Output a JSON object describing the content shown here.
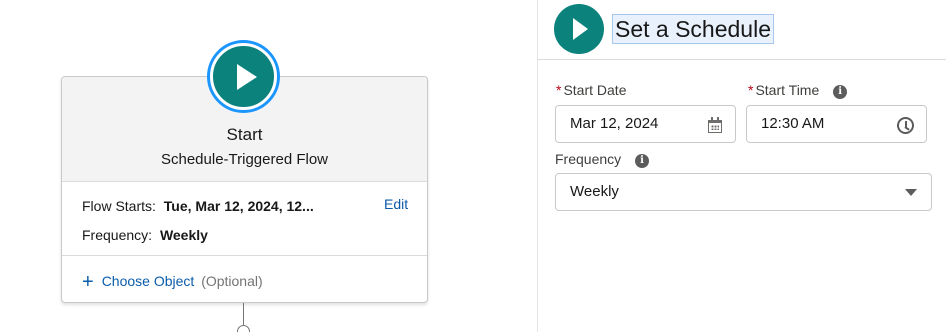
{
  "canvas": {
    "start_card": {
      "title": "Start",
      "subtitle": "Schedule-Triggered Flow",
      "flow_starts_label": "Flow Starts:",
      "flow_starts_value": "Tue, Mar 12, 2024, 12...",
      "edit_label": "Edit",
      "frequency_label": "Frequency:",
      "frequency_value": "Weekly",
      "choose_object_label": "Choose Object",
      "optional_label": "(Optional)"
    }
  },
  "panel": {
    "title": "Set a Schedule",
    "start_date": {
      "label": "Start Date",
      "required_mark": "*",
      "value": "Mar 12, 2024",
      "icon": "calendar-icon"
    },
    "start_time": {
      "label": "Start Time",
      "required_mark": "*",
      "value": "12:30 AM",
      "icon": "clock-icon"
    },
    "frequency": {
      "label": "Frequency",
      "value": "Weekly"
    },
    "info_glyph": "i"
  },
  "colors": {
    "start_teal": "#0b827c",
    "link_blue": "#0b5cab",
    "focus_ring": "#1b96ff",
    "required_red": "#ba0517"
  }
}
